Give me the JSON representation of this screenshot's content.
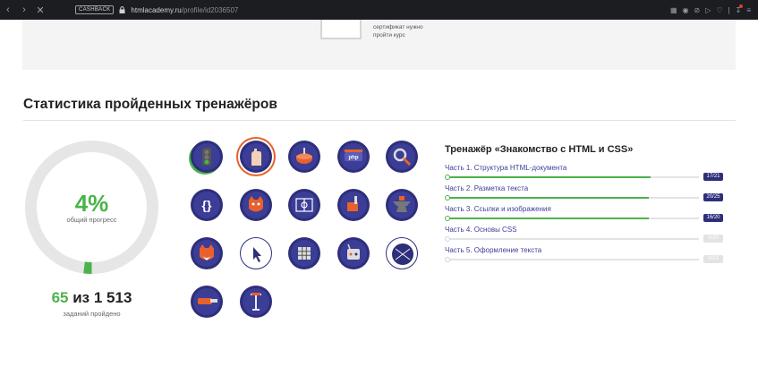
{
  "browser": {
    "cashback": "CASHBACK",
    "url_host": "htmlacademy.ru",
    "url_path": "/profile/id2036507"
  },
  "cert": {
    "text_line1": "сертификат нужно",
    "text_line2": "пройти курс"
  },
  "section": {
    "title": "Статистика пройденных тренажёров"
  },
  "progress": {
    "percent_value": 0.04,
    "percent_label": "4%",
    "percent_caption": "общий прогресс",
    "done": "65",
    "of_word": "из",
    "total": "1 513",
    "count_caption": "заданий пройдено"
  },
  "colors": {
    "accent_green": "#4bb34b",
    "badge_navy": "#2e2f7a",
    "link_purple": "#3f3f9a",
    "active_orange": "#e8612c"
  },
  "badges": [
    {
      "icon": "traffic-light-icon"
    },
    {
      "icon": "hand-icon",
      "active": true
    },
    {
      "icon": "spinning-top-icon"
    },
    {
      "icon": "php-sign-icon"
    },
    {
      "icon": "magnifier-icon"
    },
    {
      "icon": "curly-braces-icon"
    },
    {
      "icon": "cat-mascot-icon"
    },
    {
      "icon": "sports-field-icon"
    },
    {
      "icon": "paint-brush-icon"
    },
    {
      "icon": "anvil-icon"
    },
    {
      "icon": "fox-mascot-icon"
    },
    {
      "icon": "cursor-icon"
    },
    {
      "icon": "rubiks-cube-icon"
    },
    {
      "icon": "remote-control-icon"
    },
    {
      "icon": "network-icon"
    },
    {
      "icon": "chainsaw-icon"
    },
    {
      "icon": "text-cursor-icon"
    }
  ],
  "trainer": {
    "title": "Тренажёр «Знакомство с HTML и CSS»",
    "parts": [
      {
        "label": "Часть 1. Структура HTML-документа",
        "count": "17/21",
        "progress": 0.81
      },
      {
        "label": "Часть 2. Разметка текста",
        "count": "20/25",
        "progress": 0.8
      },
      {
        "label": "Часть 3. Ссылки и изображения",
        "count": "16/20",
        "progress": 0.8
      },
      {
        "label": "Часть 4. Основы CSS",
        "count": "0/20",
        "progress": 0
      },
      {
        "label": "Часть 5. Оформление текста",
        "count": "0/23",
        "progress": 0
      }
    ]
  }
}
